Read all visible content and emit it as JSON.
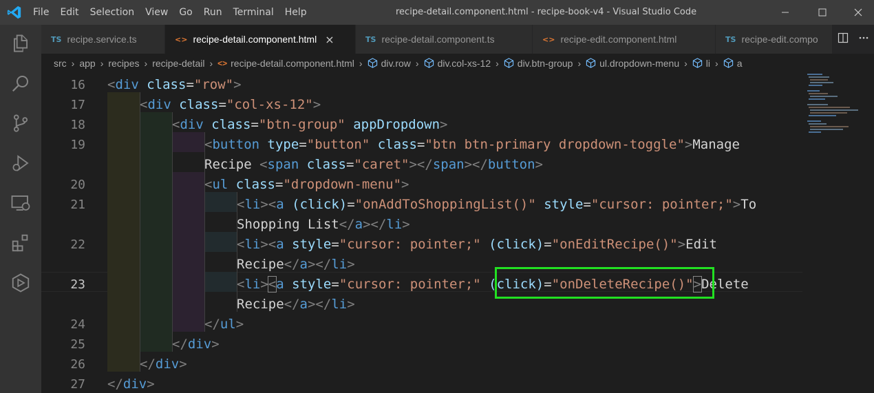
{
  "menu": [
    "File",
    "Edit",
    "Selection",
    "View",
    "Go",
    "Run",
    "Terminal",
    "Help"
  ],
  "window_title": "recipe-detail.component.html - recipe-book-v4 - Visual Studio Code",
  "tabs": [
    {
      "icon": "TS",
      "label": "recipe.service.ts"
    },
    {
      "icon": "<>",
      "label": "recipe-detail.component.html",
      "close": "×"
    },
    {
      "icon": "TS",
      "label": "recipe-detail.component.ts"
    },
    {
      "icon": "<>",
      "label": "recipe-edit.component.html"
    },
    {
      "icon": "TS",
      "label": "recipe-edit.compo"
    }
  ],
  "breadcrumb": [
    "src",
    "app",
    "recipes",
    "recipe-detail",
    "recipe-detail.component.html",
    "div.row",
    "div.col-xs-12",
    "div.btn-group",
    "ul.dropdown-menu",
    "li",
    "a"
  ],
  "line_numbers": [
    "16",
    "17",
    "18",
    "19",
    "",
    "20",
    "21",
    "",
    "22",
    "",
    "23",
    "",
    "24",
    "25",
    "26",
    "27"
  ],
  "code": {
    "l16": {
      "tag": "div",
      "attr": "class",
      "val": "\"row\""
    },
    "l17": {
      "tag": "div",
      "attr": "class",
      "val": "\"col-xs-12\""
    },
    "l18": {
      "tag": "div",
      "attr": "class",
      "val": "\"btn-group\"",
      "attr2": "appDropdown"
    },
    "l19": {
      "tag": "button",
      "attr": "type",
      "val": "\"button\"",
      "attr2": "class",
      "val2": "\"btn btn-primary dropdown-toggle\"",
      "text": "Manage"
    },
    "l19b": {
      "text": "Recipe ",
      "tag": "span",
      "attr": "class",
      "val": "\"caret\"",
      "close1": "span",
      "close2": "button"
    },
    "l20": {
      "tag": "ul",
      "attr": "class",
      "val": "\"dropdown-menu\""
    },
    "l21": {
      "tag": "li",
      "tag2": "a",
      "attr": "(click)",
      "val": "\"onAddToShoppingList()\"",
      "attr2": "style",
      "val2": "\"cursor: pointer;\"",
      "text": "To"
    },
    "l21b": {
      "text": "Shopping List",
      "close1": "a",
      "close2": "li"
    },
    "l22": {
      "tag": "li",
      "tag2": "a",
      "attr": "style",
      "val": "\"cursor: pointer;\"",
      "attr2": "(click)",
      "val2": "\"onEditRecipe()\"",
      "text": "Edit"
    },
    "l22b": {
      "text": "Recipe",
      "close1": "a",
      "close2": "li"
    },
    "l23": {
      "tag": "li",
      "tag2": "a",
      "attr": "style",
      "val": "\"cursor: pointer;\"",
      "attr2": "(click)",
      "val2": "\"onDeleteRecipe()\"",
      "text": "Delete"
    },
    "l23b": {
      "text": "Recipe",
      "close1": "a",
      "close2": "li"
    },
    "l24": {
      "close": "ul"
    },
    "l25": {
      "close": "div"
    },
    "l26": {
      "close": "div"
    },
    "l27": {
      "close": "div"
    }
  },
  "colors": {
    "highlight": "#22e022",
    "tag": "#569cd6",
    "attr": "#9cdcfe",
    "string": "#ce9178"
  },
  "icons": [
    "vscode-logo",
    "explorer-icon",
    "search-icon",
    "source-control-icon",
    "run-debug-icon",
    "remote-explorer-icon",
    "extensions-icon",
    "angular-icon",
    "split-editor-icon",
    "more-actions-icon"
  ]
}
